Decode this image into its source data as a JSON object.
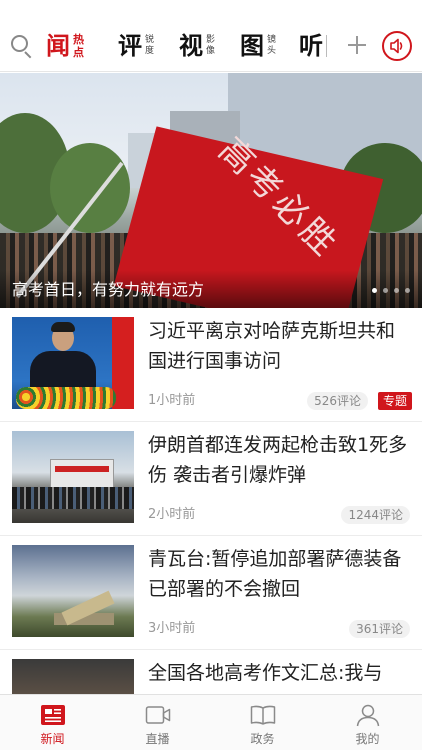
{
  "nav": {
    "tabs": [
      {
        "big": "闻",
        "small": [
          "热",
          "点"
        ],
        "active": true
      },
      {
        "big": "评",
        "small": [
          "锐",
          "度"
        ]
      },
      {
        "big": "视",
        "small": [
          "影",
          "像"
        ]
      },
      {
        "big": "图",
        "small": [
          "镜",
          "头"
        ]
      },
      {
        "big": "听",
        "small": [
          "",
          ""
        ]
      }
    ],
    "search_icon": "search-icon",
    "add_icon": "plus-icon",
    "audio_icon": "speaker-icon"
  },
  "hero": {
    "caption": "高考首日，有努力就有远方",
    "flag_text": "高考必胜",
    "slide_count": 4,
    "active_slide": 0
  },
  "articles": [
    {
      "title": "习近平离京对哈萨克斯坦共和国进行国事访问",
      "time": "1小时前",
      "comments": "526评论",
      "tag": "专题"
    },
    {
      "title": "伊朗首都连发两起枪击致1死多伤 袭击者引爆炸弹",
      "time": "2小时前",
      "comments": "1244评论"
    },
    {
      "title": "青瓦台:暂停追加部署萨德装备 已部署的不会撤回",
      "time": "3小时前",
      "comments": "361评论"
    },
    {
      "title": "全国各地高考作文汇总:我与",
      "time": "",
      "comments": ""
    }
  ],
  "tabbar": [
    {
      "label": "新闻",
      "icon": "news-icon",
      "active": true
    },
    {
      "label": "直播",
      "icon": "live-video-icon"
    },
    {
      "label": "政务",
      "icon": "book-icon"
    },
    {
      "label": "我的",
      "icon": "user-icon"
    }
  ],
  "colors": {
    "accent": "#d0161c",
    "muted": "#999999"
  }
}
